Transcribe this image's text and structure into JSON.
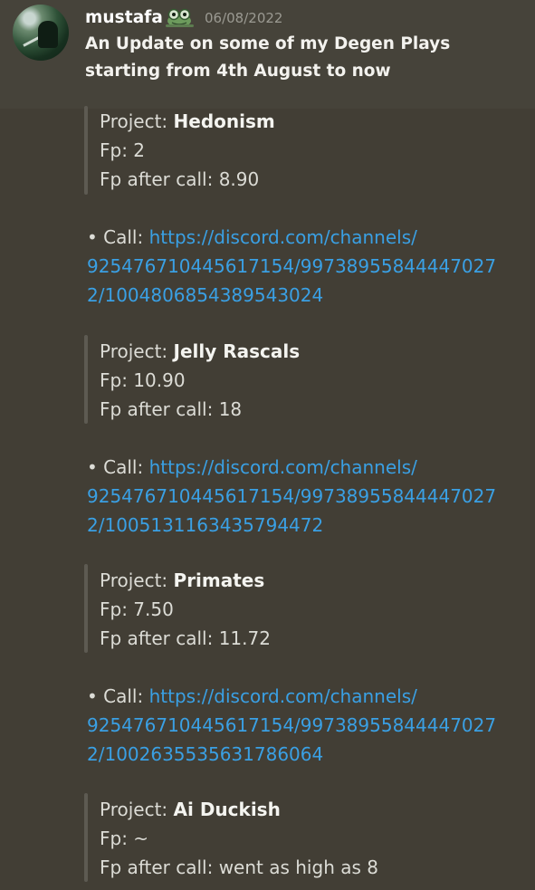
{
  "message": {
    "username": "mustafa",
    "timestamp": "06/08/2022",
    "headline_lines": [
      "An Update on some of my Degen Plays",
      "starting from 4th August to now"
    ]
  },
  "entries": [
    {
      "project_label": "Project:",
      "project_name": "Hedonism",
      "fp": "Fp: 2",
      "fp_after": "Fp after call: 8.90",
      "call_label": "• Call:",
      "link_lines": [
        "https://discord.com/channels/",
        "925476710445617154/99738955844447027",
        "2/1004806854389543024"
      ]
    },
    {
      "project_label": "Project:",
      "project_name": "Jelly Rascals",
      "fp": "Fp: 10.90",
      "fp_after": "Fp after call: 18",
      "call_label": "• Call:",
      "link_lines": [
        "https://discord.com/channels/",
        "925476710445617154/99738955844447027",
        "2/1005131163435794472"
      ]
    },
    {
      "project_label": "Project:",
      "project_name": "Primates",
      "fp": "Fp: 7.50",
      "fp_after": "Fp after call: 11.72",
      "call_label": "• Call:",
      "link_lines": [
        "https://discord.com/channels/",
        "925476710445617154/99738955844447027",
        "2/1002635535631786064"
      ]
    },
    {
      "project_label": "Project:",
      "project_name": "Ai Duckish",
      "fp": "Fp: ~",
      "fp_after": "Fp after call: went as high as 8"
    }
  ],
  "icons": {
    "avatar": "user-avatar",
    "badge": "frog-emoji-icon"
  },
  "colors": {
    "background": "#464239",
    "link": "#3aa0e4",
    "username": "#ffffff",
    "timestamp": "#9b9a92",
    "quote_bar": "#5d5a52"
  }
}
